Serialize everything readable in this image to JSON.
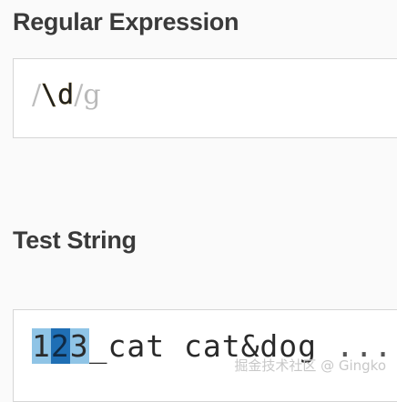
{
  "regex_section": {
    "title": "Regular Expression",
    "open_delimiter": "/",
    "pattern": "\\d",
    "close_delimiter": "/",
    "flags": "g"
  },
  "test_section": {
    "title": "Test String",
    "matches": [
      "1",
      "2",
      "3"
    ],
    "rest_text": "_cat cat&dog",
    "ellipsis": "..."
  },
  "watermark": "掘金技术社区 @ Gingko",
  "colors": {
    "match_light": "#8fc4e6",
    "match_dark": "#1f6fb5",
    "delimiter": "#bdbdbd"
  }
}
